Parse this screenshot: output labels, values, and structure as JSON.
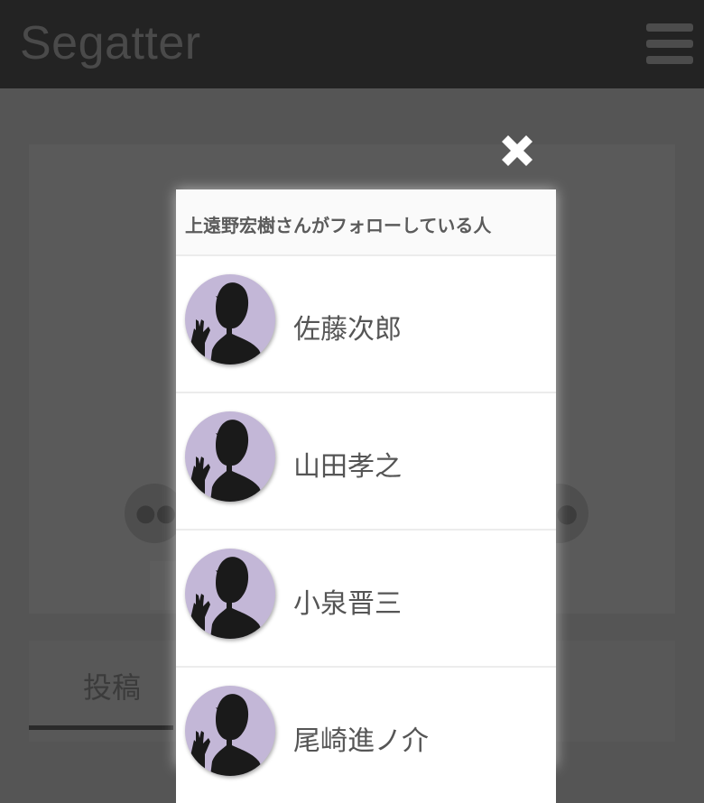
{
  "app": {
    "title": "Segatter"
  },
  "background": {
    "tab_label": "投稿"
  },
  "modal": {
    "title": "上遠野宏樹さんがフォローしている人",
    "users": [
      {
        "name": "佐藤次郎"
      },
      {
        "name": "山田孝之"
      },
      {
        "name": "小泉晋三"
      },
      {
        "name": "尾崎進ノ介"
      }
    ]
  },
  "colors": {
    "appbar": "#232323",
    "overlay": "#555555",
    "avatar_bg": "#c3b7d7",
    "name_text": "#555555"
  },
  "icons": {
    "menu": "hamburger-icon",
    "close": "close-icon",
    "avatar": "person-silhouette-icon"
  }
}
